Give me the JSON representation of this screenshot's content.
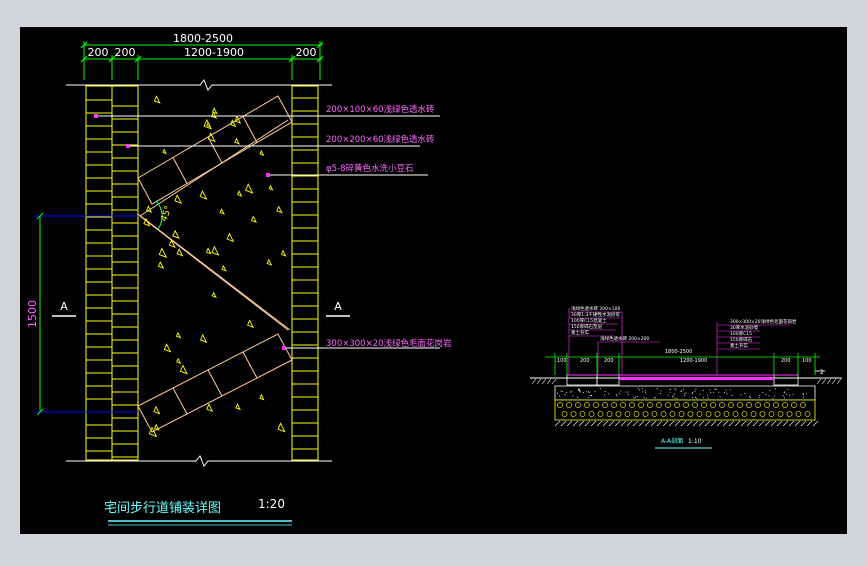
{
  "colors": {
    "frame": "#d2d5da",
    "canvas": "#000000",
    "dim": "#00ff00",
    "text": "#ffffff",
    "label_text": "#ff66ff",
    "leader": "#ff33ff",
    "pavers": "#ffff00",
    "pebbles": "#ffff00",
    "stone": "#ffcc99",
    "title": "#66ffff",
    "arc": "#00ff88",
    "level_line": "#0000ff"
  },
  "plan": {
    "dims_top": {
      "overall": "1800-2500",
      "left_a": "200",
      "left_b": "200",
      "middle": "1200-1900",
      "right": "200"
    },
    "dim_left": "1500",
    "section_marks": {
      "left": "A",
      "right": "A"
    },
    "angle": "45°",
    "labels": [
      "200×100×60浅绿色透水砖",
      "200×200×60浅绿色透水砖",
      "φ5-8碎黄色水洗小豆石",
      "300×300×20浅绿色毛面花岗岩"
    ],
    "title": "宅间步行道铺装详图",
    "scale": "1:20"
  },
  "section": {
    "title": "A-A剖面",
    "scale": "1:10"
  }
}
